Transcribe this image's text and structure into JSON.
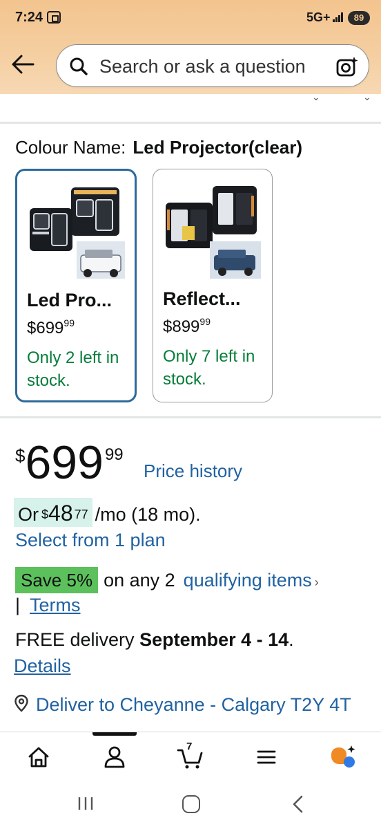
{
  "status_bar": {
    "time": "7:24",
    "network": "5G+",
    "battery": "89"
  },
  "search": {
    "placeholder": "Search or ask a question"
  },
  "colour": {
    "label": "Colour Name:",
    "value": "Led Projector(clear)"
  },
  "swatches": [
    {
      "name": "Led Pro...",
      "price_currency": "$",
      "price_whole": "699",
      "price_fraction": "99",
      "stock": "Only 2 left in stock.",
      "selected": true
    },
    {
      "name": "Reflect...",
      "price_currency": "$",
      "price_whole": "899",
      "price_fraction": "99",
      "stock": "Only 7 left in stock.",
      "selected": false
    }
  ],
  "price": {
    "currency": "$",
    "whole": "699",
    "fraction": "99",
    "history_link": "Price history"
  },
  "financing": {
    "prefix": "Or",
    "currency": "$",
    "whole": "48",
    "fraction": "77",
    "suffix": "/mo (18 mo).",
    "plan_link": "Select from 1 plan"
  },
  "promotion": {
    "badge": "Save 5%",
    "text": "on any 2",
    "link": "qualifying items",
    "separator": "|",
    "terms_link": "Terms"
  },
  "delivery": {
    "prefix": "FREE delivery",
    "dates": "September 4 - 14",
    "suffix": ".",
    "details_link": "Details",
    "deliver_to": "Deliver to Cheyanne - Calgary T2Y 4T"
  },
  "bottom_nav": {
    "cart_count": "7",
    "items": [
      "home-icon",
      "account-icon",
      "cart-icon",
      "menu-icon",
      "rufus-icon"
    ]
  },
  "colors": {
    "header": "#f3c48e",
    "link": "#2162a1",
    "in_stock": "#067d3a",
    "save_badge": "#5cc15c",
    "finance_highlight": "#d6f2ea",
    "selected_border": "#2c6a9a"
  }
}
